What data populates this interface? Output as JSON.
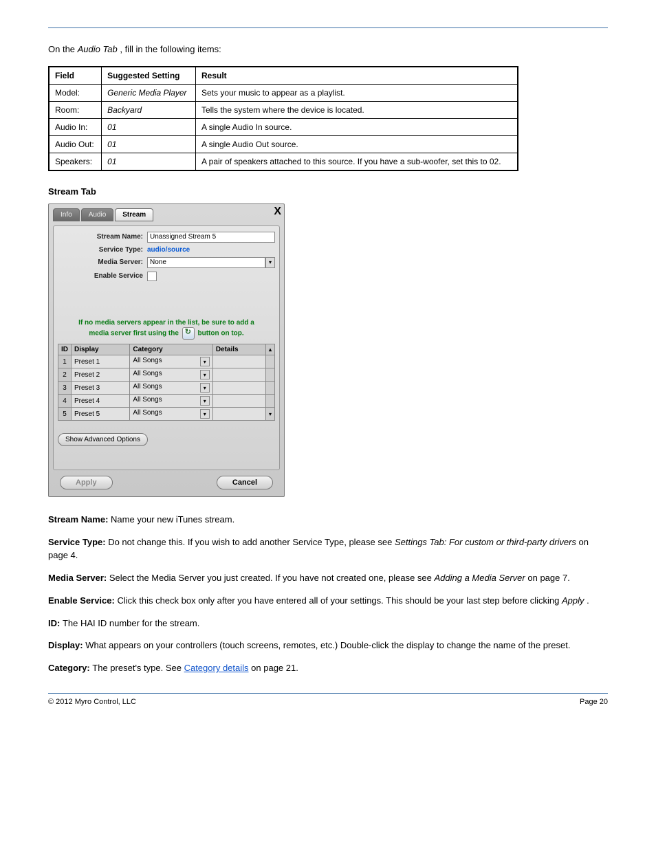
{
  "intro": {
    "pre": "On the ",
    "em": "Audio Tab",
    "post": ", fill in the following items:"
  },
  "table": {
    "headers": [
      "Field",
      "Suggested Setting",
      "Result"
    ],
    "rows": [
      [
        "Model:",
        "Generic Media Player",
        "Sets your music to appear as a playlist."
      ],
      [
        "Room:",
        "Backyard",
        "Tells the system where the device is located."
      ],
      [
        "Audio In:",
        "01",
        "A single Audio In source."
      ],
      [
        "Audio Out:",
        "01",
        "A single Audio Out source."
      ],
      [
        "Speakers:",
        "01",
        "A pair of speakers attached to this source. If you have a sub-woofer, set this to 02."
      ]
    ]
  },
  "streamLabel": "Stream Tab",
  "dialog": {
    "close": "X",
    "tabs": [
      "Info",
      "Audio",
      "Stream"
    ],
    "fields": {
      "streamName": {
        "label": "Stream Name:",
        "value": "Unassigned Stream 5"
      },
      "serviceType": {
        "label": "Service Type:",
        "value": "audio/source"
      },
      "mediaServer": {
        "label": "Media Server:",
        "value": "None"
      },
      "enableService": {
        "label": "Enable Service"
      }
    },
    "hint": {
      "line1": "If no media servers appear in the list, be sure to add a",
      "line2a": "media server first using the",
      "line2b": "button on top."
    },
    "presetTable": {
      "headers": [
        "ID",
        "Display",
        "Category",
        "Details"
      ],
      "rows": [
        {
          "id": "1",
          "display": "Preset 1",
          "category": "All Songs"
        },
        {
          "id": "2",
          "display": "Preset 2",
          "category": "All Songs"
        },
        {
          "id": "3",
          "display": "Preset 3",
          "category": "All Songs"
        },
        {
          "id": "4",
          "display": "Preset 4",
          "category": "All Songs"
        },
        {
          "id": "5",
          "display": "Preset 5",
          "category": "All Songs"
        }
      ]
    },
    "advanced": "Show Advanced Options",
    "apply": "Apply",
    "cancel": "Cancel"
  },
  "body": {
    "p1": {
      "label": "Stream Name: ",
      "text": "Name your new iTunes stream."
    },
    "p2": {
      "label": "Service Type: ",
      "t1": "Do not change this. If you wish to add another Service Type, please see ",
      "em1": "Settings Tab: For custom or third-party drivers",
      "t2": " on page 4."
    },
    "p3": {
      "label": "Media Server: ",
      "t1": "Select the Media Server you just created. If you have not created one, please see ",
      "em1": "Adding a Media Server",
      "t2": " on page 7."
    },
    "p4": {
      "label": "Enable Service: ",
      "t1": "Click this check box only after you have entered all of your settings. This should be your last step before clicking ",
      "em1": "Apply",
      "t2": "."
    },
    "p5": {
      "label": "ID: ",
      "text": "The HAI ID number for the stream."
    },
    "p6": {
      "label": "Display: ",
      "text": "What appears on your controllers (touch screens, remotes, etc.) Double-click the display to change the name of the preset."
    },
    "p7": {
      "label": "Category: ",
      "t1": "The preset's type. See ",
      "link": "Category details",
      "t2": " on page 21."
    }
  },
  "footer": {
    "left": "© 2012 Myro Control, LLC",
    "right": "Page 20"
  }
}
